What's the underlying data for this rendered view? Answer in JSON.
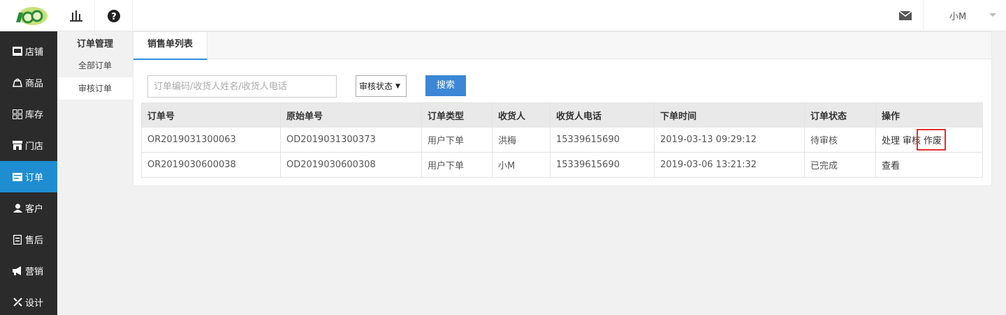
{
  "topbar": {
    "user_name": "小M"
  },
  "leftnav": {
    "items": [
      {
        "label": "店铺",
        "icon": "store-icon"
      },
      {
        "label": "商品",
        "icon": "product-icon"
      },
      {
        "label": "库存",
        "icon": "inventory-icon"
      },
      {
        "label": "门店",
        "icon": "shop-icon"
      },
      {
        "label": "订单",
        "icon": "order-icon",
        "active": true
      },
      {
        "label": "客户",
        "icon": "customer-icon"
      },
      {
        "label": "售后",
        "icon": "aftersale-icon"
      },
      {
        "label": "营销",
        "icon": "marketing-icon"
      },
      {
        "label": "设计",
        "icon": "design-icon"
      }
    ]
  },
  "subnav": {
    "title": "订单管理",
    "items": [
      {
        "label": "全部订单"
      },
      {
        "label": "审核订单",
        "active": true
      }
    ]
  },
  "main": {
    "tab_label": "销售单列表",
    "search_placeholder": "订单编码/收货人姓名/收货人电话",
    "status_select": "审核状态",
    "search_button": "搜索"
  },
  "table": {
    "headers": [
      "订单号",
      "原始单号",
      "订单类型",
      "收货人",
      "收货人电话",
      "下单时间",
      "订单状态",
      "操作"
    ],
    "rows": [
      {
        "order_no": "OR2019031300063",
        "origin_no": "OD2019031300373",
        "type": "用户下单",
        "receiver": "洪梅",
        "phone": "15339615690",
        "time": "2019-03-13 09:29:12",
        "status": "待审核",
        "actions": [
          "处理",
          "审核",
          "作废"
        ]
      },
      {
        "order_no": "OR2019030600038",
        "origin_no": "OD2019030600308",
        "type": "用户下单",
        "receiver": "小M",
        "phone": "15339615690",
        "time": "2019-03-06 13:21:32",
        "status": "已完成",
        "actions": [
          "查看"
        ]
      }
    ]
  },
  "colors": {
    "accent": "#1e8dd1",
    "button": "#3b87d6",
    "highlight": "#e5302e",
    "nav_bg": "#2b2b2b"
  }
}
